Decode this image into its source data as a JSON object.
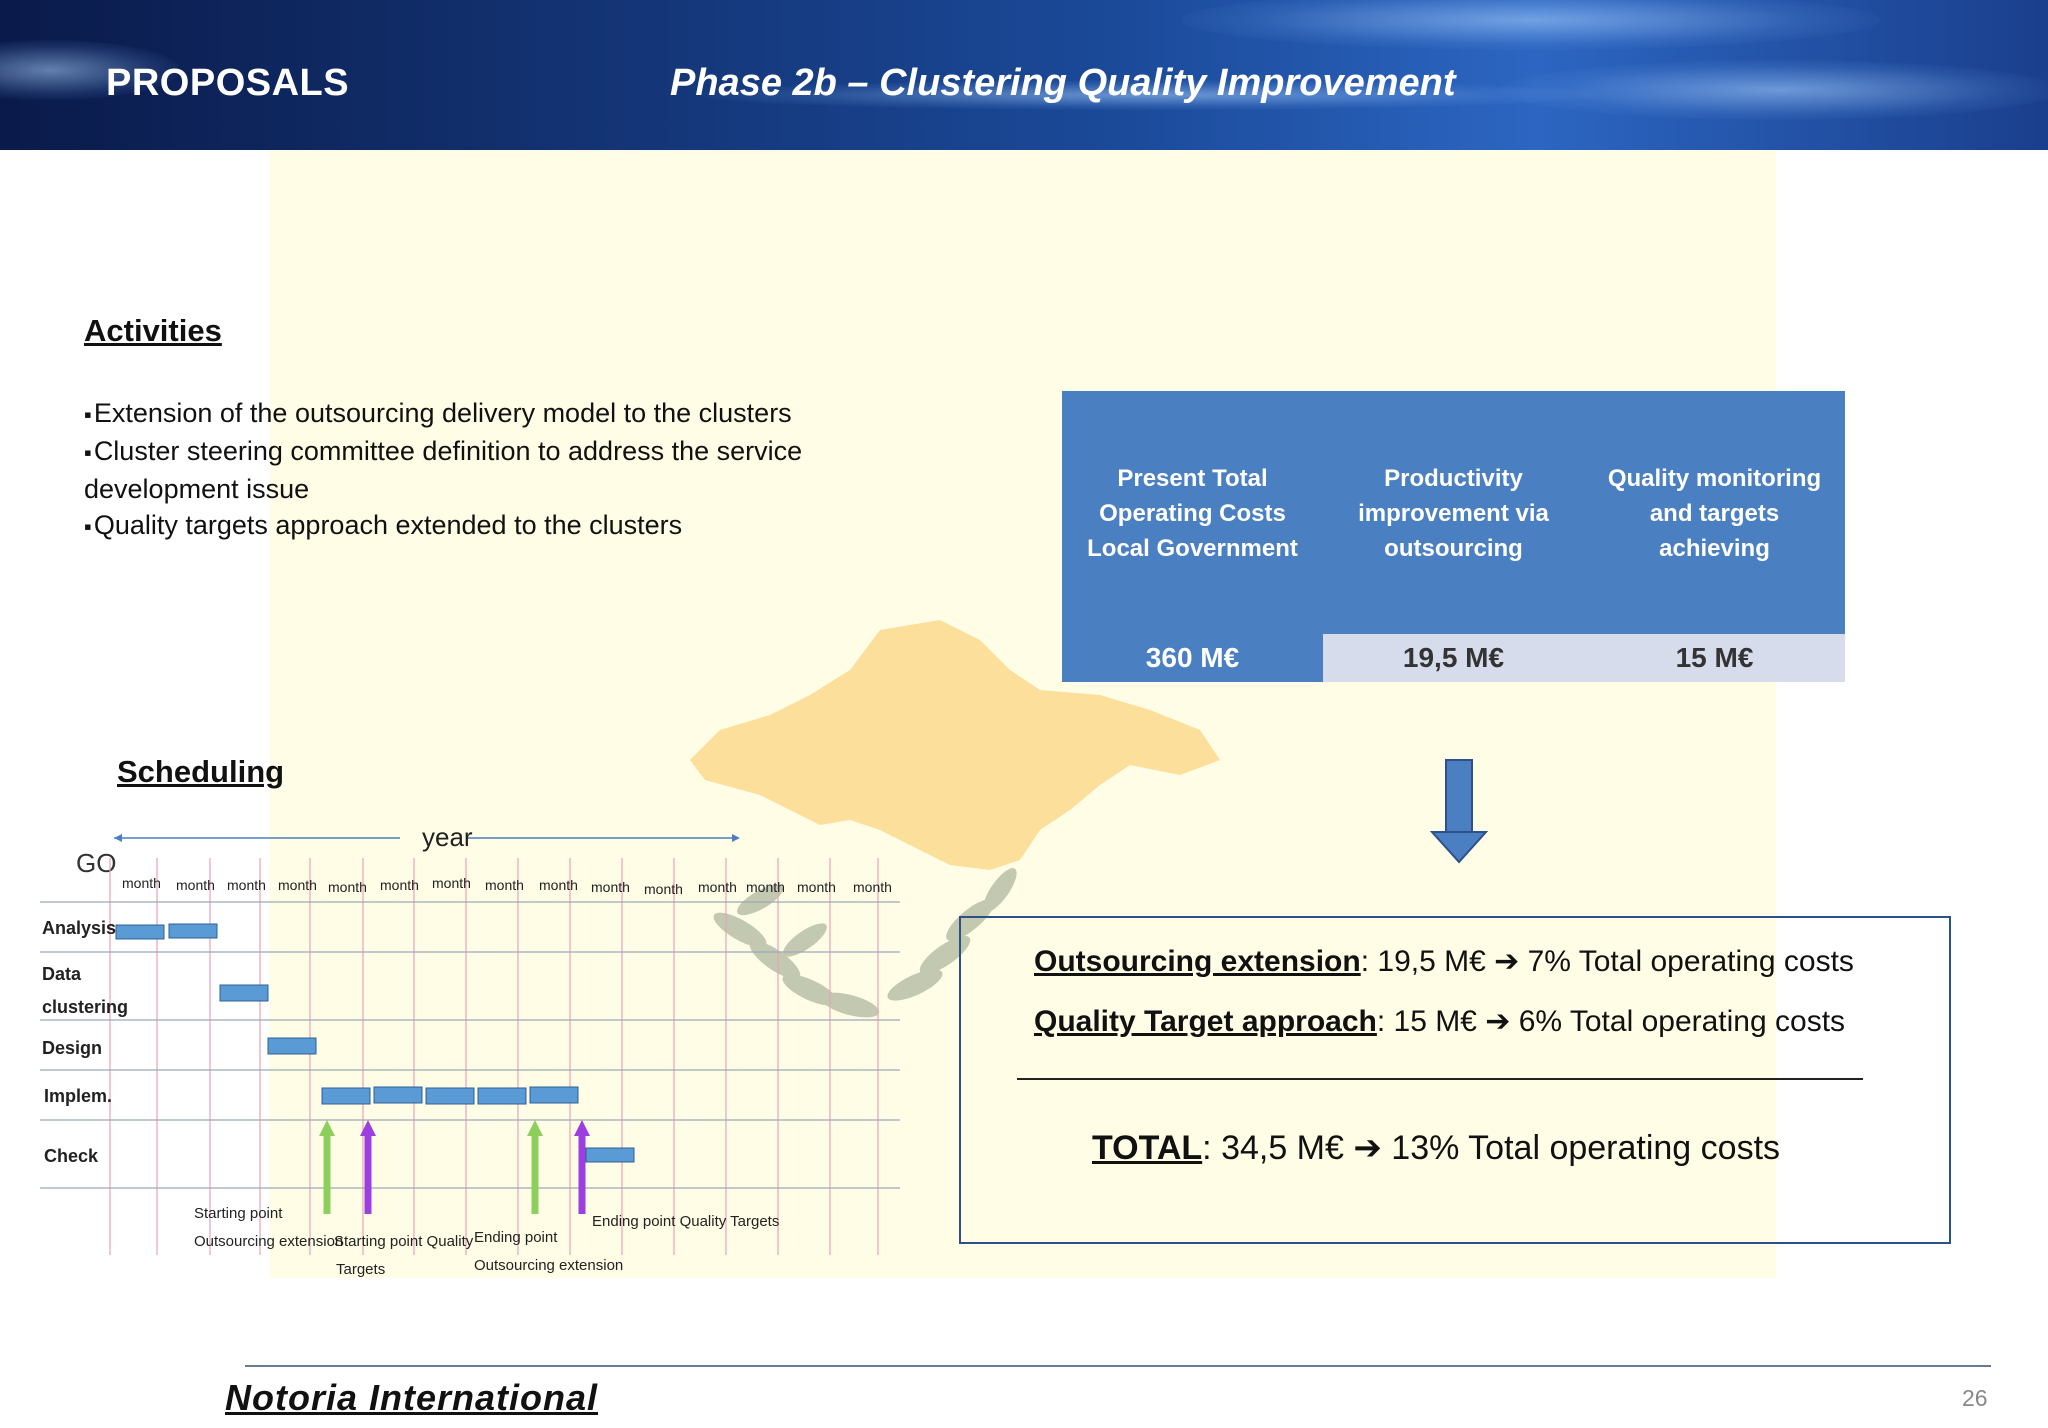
{
  "header": {
    "section": "PROPOSALS",
    "title": "Phase 2b – Clustering Quality Improvement"
  },
  "activities": {
    "heading": "Activities",
    "items": [
      "Extension of the outsourcing delivery model to the clusters",
      "Cluster steering committee definition to address the service development issue",
      "Quality targets approach extended to the clusters"
    ]
  },
  "cost_table": {
    "columns": [
      {
        "line1": "Present Total",
        "line2": "Operating Costs",
        "line3": "Local Government",
        "value": "360 M€"
      },
      {
        "line1": "Productivity",
        "line2": "improvement via",
        "line3": "outsourcing",
        "value": "19,5 M€"
      },
      {
        "line1": "Quality monitoring",
        "line2": "and targets",
        "line3": "achieving",
        "value": "15 M€"
      }
    ],
    "colors": {
      "header": "#4a7fc1",
      "value_light": "#d6dceb"
    }
  },
  "summary": {
    "line1_label": "Outsourcing extension",
    "line1_rest": ": 19,5 M€ ➔ 7% Total operating costs",
    "line2_label": "Quality Target approach",
    "line2_rest": ": 15 M€ ➔ 6% Total operating costs",
    "total_label": "TOTAL",
    "total_rest": ": 34,5 M€ ➔ 13% Total operating costs"
  },
  "scheduling": {
    "heading": "Scheduling",
    "go_label": "GO",
    "year_label": "year",
    "month_label": "month",
    "rows": [
      "Analysis",
      "Data clustering",
      "Design",
      "Implem.",
      "Check"
    ],
    "milestones": [
      {
        "label1": "Starting point",
        "label2": "Outsourcing extension"
      },
      {
        "label1": "Starting point Quality",
        "label2": "Targets"
      },
      {
        "label1": "Ending point",
        "label2": "Outsourcing extension"
      },
      {
        "label1": "Ending point Quality Targets",
        "label2": ""
      }
    ],
    "colors": {
      "bar": "#5b9bd5",
      "green_arrow": "#8ccf5c",
      "purple_arrow": "#9b3fe0"
    }
  },
  "footer": {
    "brand": "Notoria International",
    "page": "26"
  }
}
